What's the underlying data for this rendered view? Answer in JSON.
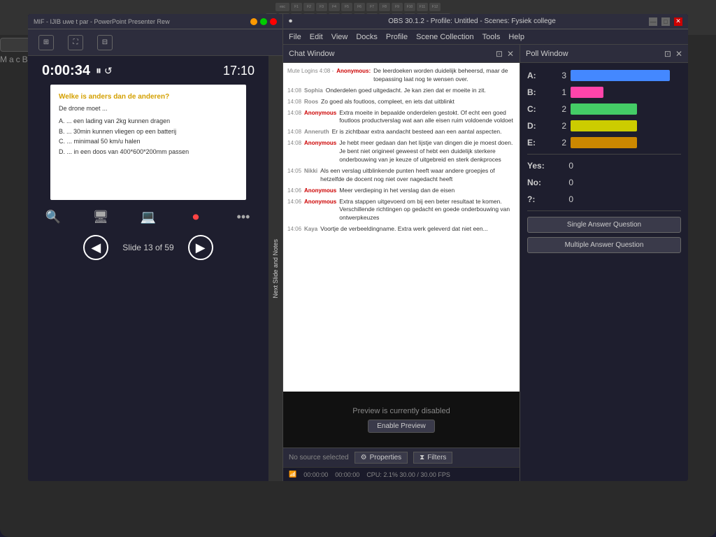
{
  "laptop": {
    "brand": "MacBook Pro"
  },
  "ppt_window": {
    "title": "MIF - IJIB uwe t par - PowerPoint Presenter Rew",
    "timer": "0:00:34",
    "pause_icon": "⏸",
    "refresh_icon": "↺",
    "end_time": "17:10",
    "slide": {
      "question": "Welke is anders dan de anderen?",
      "subtitle": "De drone moet ...",
      "options": [
        "A.  ... een lading van 2kg kunnen dragen",
        "B.  ... 30min kunnen vliegen op een batterij",
        "C.  ... minimaal 50 km/u halen",
        "D.  ... in een doos van 400*600*200mm passen"
      ]
    },
    "nav": {
      "prev_label": "◀",
      "slide_info": "Slide 13 of 59",
      "next_label": "▶"
    },
    "side_panel_text": "Next Slide and Notes",
    "icons": {
      "search": "🔍",
      "monitor": "🖥",
      "desktop": "💻",
      "record": "⏺",
      "more": "•••"
    }
  },
  "obs_window": {
    "title": "OBS 30.1.2 - Profile: Untitled - Scenes: Fysiek college",
    "menu_items": [
      "File",
      "Edit",
      "View",
      "Docks",
      "Profile",
      "Scene Collection",
      "Tools",
      "Help"
    ],
    "chat_panel": {
      "title": "Chat Window",
      "messages": [
        {
          "time": "Mute Logins",
          "prefix": "4:08 - Anonymous:",
          "user": "",
          "text": "De leerdoeken worden duidelijk beheerset, maar de toepassing laat nog te wensen over."
        },
        {
          "time": "14:08",
          "prefix": "",
          "user": "Sophia",
          "text": "Onderdelen goed uitgedacht. Je kan zien dat er moeite in zit."
        },
        {
          "time": "14:08",
          "prefix": "",
          "user": "Roos",
          "text": "Zo goed als foutloos, compleet, en iets dat uitblinkt"
        },
        {
          "time": "14:08",
          "prefix": "",
          "user": "Anonymous",
          "text": "Extra moeite in bepaalde onderdelen geslogt. Of echt een goed foutloos productverslag wat aan alle eisen ruim voldoende voldoet"
        },
        {
          "time": "14:08",
          "prefix": "",
          "user": "Anneruth",
          "text": "Er is zichtbaar extra aandacht besteed aan een aantal aspecten."
        },
        {
          "time": "14:08",
          "prefix": "",
          "user": "Anonymous",
          "text": "Je hebt meer gedaan dan het lijstje van dingen die je moest doen. Je bent niet origineel geweest of hebt een duidelijk sterkere onderbouwing van je keuze of uitgebreid en sterk denkproces"
        },
        {
          "time": "14:05",
          "prefix": "",
          "user": "Nikki",
          "text": "Als een verslag uitblinkende punten heeft waar andere groepjes of hetzelfde de docent nog niet over nagedacht heeft"
        },
        {
          "time": "14:06",
          "prefix": "",
          "user": "Anonymous",
          "text": "Meer verdieping in het verslag dan de eisen"
        },
        {
          "time": "14:06",
          "prefix": "",
          "user": "Anonymous",
          "text": "Extra stappen uitgevoerd om bij een beter resultaat te komen. Verschillende richtingen op gedacht en goede onderbouwing van ontwerpkeuzes"
        },
        {
          "time": "14:06",
          "prefix": "",
          "user": "Kaya",
          "text": "Voortje de verbeeldinagme. Extra werk gehleverd dat niet een..."
        }
      ]
    },
    "preview": {
      "disabled_text": "Preview is currently disabled",
      "enable_btn": "Enable Preview"
    },
    "bottom_bar": {
      "no_source": "No source selected",
      "properties_btn": "Properties",
      "filters_btn": "Filters"
    },
    "status_bar": {
      "cpu_text": "CPU: 2.1% 30.00 / 30.00 FPS",
      "time1": "00:00:00",
      "time2": "00:00:00"
    }
  },
  "poll_window": {
    "title": "Poll Window",
    "options": [
      {
        "label": "A:",
        "count": 3,
        "bar_pct": 90,
        "color": "blue"
      },
      {
        "label": "B:",
        "count": 1,
        "bar_pct": 30,
        "color": "pink"
      },
      {
        "label": "C:",
        "count": 2,
        "bar_pct": 60,
        "color": "green"
      },
      {
        "label": "D:",
        "count": 2,
        "bar_pct": 60,
        "color": "yellow"
      },
      {
        "label": "E:",
        "count": 2,
        "bar_pct": 60,
        "color": "orange"
      },
      {
        "label": "Yes:",
        "count": 0,
        "bar_pct": 0,
        "color": "blue"
      },
      {
        "label": "No:",
        "count": 0,
        "bar_pct": 0,
        "color": "pink"
      },
      {
        "label": "?:",
        "count": 0,
        "bar_pct": 0,
        "color": "green"
      }
    ],
    "single_btn": "Single Answer Question",
    "multiple_btn": "Multiple Answer Question"
  }
}
